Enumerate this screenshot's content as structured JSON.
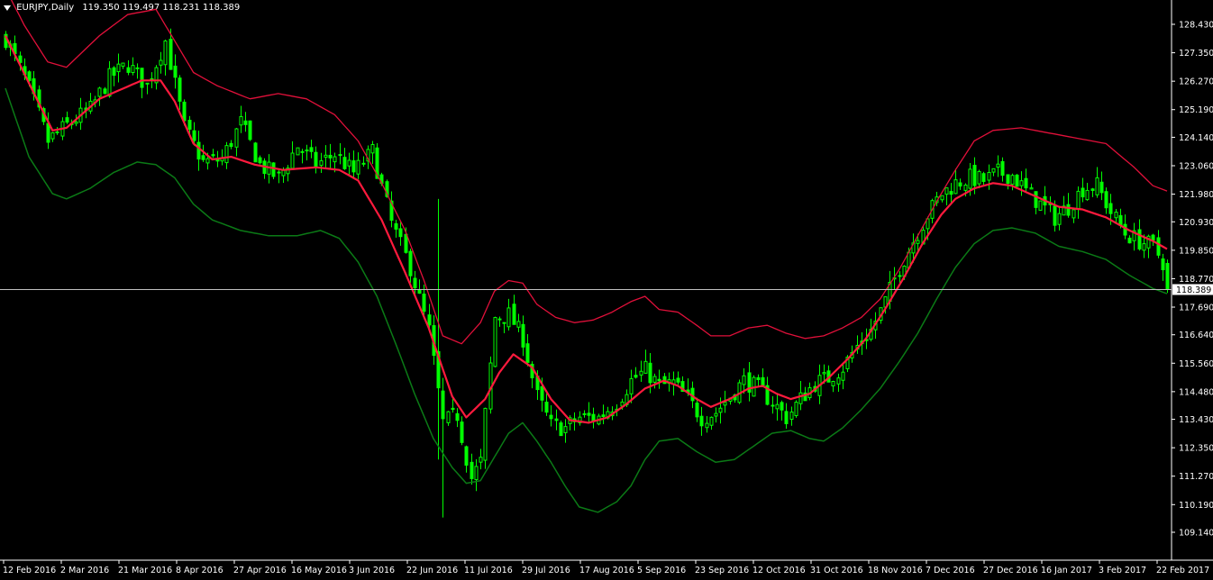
{
  "header": {
    "symbol": "EURJPY,Daily",
    "ohlc": "119.350 119.497 118.231 118.389"
  },
  "colors": {
    "background": "#000000",
    "axis": "#ffffff",
    "candles": "#00ff00",
    "middle_band": "#ff1a3d",
    "upper_band": "#e0103a",
    "lower_band": "#0b7a16",
    "price_line": "#c0c0c0"
  },
  "chart_data": {
    "type": "candlestick",
    "title": "EURJPY,Daily",
    "current_price": 118.389,
    "current_price_label": "118.389",
    "ylim": [
      109.14,
      128.43
    ],
    "y_ticks": [
      "128.430",
      "127.350",
      "126.270",
      "125.190",
      "124.140",
      "123.060",
      "121.980",
      "120.930",
      "119.850",
      "118.770",
      "117.690",
      "116.640",
      "115.560",
      "114.480",
      "113.430",
      "112.350",
      "111.270",
      "110.190",
      "109.140"
    ],
    "x_ticks": [
      "12 Feb 2016",
      "2 Mar 2016",
      "21 Mar 2016",
      "8 Apr 2016",
      "27 Apr 2016",
      "16 May 2016",
      "3 Jun 2016",
      "22 Jun 2016",
      "11 Jul 2016",
      "29 Jul 2016",
      "17 Aug 2016",
      "5 Sep 2016",
      "23 Sep 2016",
      "12 Oct 2016",
      "31 Oct 2016",
      "18 Nov 2016",
      "7 Dec 2016",
      "27 Dec 2016",
      "16 Jan 2017",
      "3 Feb 2017",
      "22 Feb 2017"
    ],
    "close_path": [
      [
        0,
        127.9
      ],
      [
        5,
        126.0
      ],
      [
        9,
        124.0
      ],
      [
        13,
        124.6
      ],
      [
        18,
        125.2
      ],
      [
        22,
        126.4
      ],
      [
        26,
        126.9
      ],
      [
        30,
        126.1
      ],
      [
        34,
        127.8
      ],
      [
        38,
        124.5
      ],
      [
        42,
        123.2
      ],
      [
        46,
        123.3
      ],
      [
        50,
        124.7
      ],
      [
        54,
        123.1
      ],
      [
        58,
        122.6
      ],
      [
        62,
        123.8
      ],
      [
        66,
        123.1
      ],
      [
        70,
        123.5
      ],
      [
        74,
        122.8
      ],
      [
        78,
        123.6
      ],
      [
        82,
        120.9
      ],
      [
        86,
        119.2
      ],
      [
        90,
        116.8
      ],
      [
        93,
        113.3
      ],
      [
        96,
        113.6
      ],
      [
        99,
        111.2
      ],
      [
        101,
        111.8
      ],
      [
        104,
        117.3
      ],
      [
        107,
        117.4
      ],
      [
        110,
        116.5
      ],
      [
        113,
        114.3
      ],
      [
        116,
        113.2
      ],
      [
        119,
        113.1
      ],
      [
        122,
        113.5
      ],
      [
        126,
        113.5
      ],
      [
        130,
        114.1
      ],
      [
        133,
        114.9
      ],
      [
        136,
        115.3
      ],
      [
        139,
        114.7
      ],
      [
        142,
        114.8
      ],
      [
        145,
        114.2
      ],
      [
        148,
        113.5
      ],
      [
        151,
        113.7
      ],
      [
        154,
        114.3
      ],
      [
        157,
        114.9
      ],
      [
        160,
        114.6
      ],
      [
        163,
        114.1
      ],
      [
        166,
        113.5
      ],
      [
        169,
        114.2
      ],
      [
        172,
        114.8
      ],
      [
        175,
        115.0
      ],
      [
        178,
        115.4
      ],
      [
        181,
        116.2
      ],
      [
        184,
        116.8
      ],
      [
        187,
        117.9
      ],
      [
        190,
        119.2
      ],
      [
        193,
        120.2
      ],
      [
        196,
        121.2
      ],
      [
        199,
        122.0
      ],
      [
        202,
        122.4
      ],
      [
        205,
        122.6
      ],
      [
        208,
        122.5
      ],
      [
        211,
        122.8
      ],
      [
        214,
        122.7
      ],
      [
        217,
        122.1
      ],
      [
        220,
        121.6
      ],
      [
        223,
        121.1
      ],
      [
        226,
        121.5
      ],
      [
        229,
        122.2
      ],
      [
        232,
        122.3
      ],
      [
        235,
        121.3
      ],
      [
        238,
        120.5
      ],
      [
        241,
        120.2
      ],
      [
        244,
        120.0
      ],
      [
        246,
        119.4
      ],
      [
        247,
        118.389
      ]
    ],
    "middle_band": [
      [
        0,
        128.0
      ],
      [
        10,
        124.4
      ],
      [
        13,
        124.5
      ],
      [
        20,
        125.6
      ],
      [
        29,
        126.3
      ],
      [
        33,
        126.3
      ],
      [
        36,
        125.5
      ],
      [
        40,
        123.9
      ],
      [
        44,
        123.3
      ],
      [
        48,
        123.4
      ],
      [
        53,
        123.1
      ],
      [
        59,
        122.9
      ],
      [
        66,
        123.0
      ],
      [
        71,
        122.9
      ],
      [
        75,
        122.5
      ],
      [
        80,
        121.0
      ],
      [
        85,
        119.0
      ],
      [
        90,
        116.9
      ],
      [
        95,
        114.3
      ],
      [
        98,
        113.5
      ],
      [
        102,
        114.2
      ],
      [
        105,
        115.2
      ],
      [
        108,
        115.9
      ],
      [
        112,
        115.4
      ],
      [
        116,
        114.2
      ],
      [
        120,
        113.4
      ],
      [
        124,
        113.3
      ],
      [
        128,
        113.5
      ],
      [
        132,
        114.0
      ],
      [
        136,
        114.6
      ],
      [
        140,
        114.9
      ],
      [
        143,
        114.7
      ],
      [
        147,
        114.2
      ],
      [
        150,
        113.9
      ],
      [
        154,
        114.2
      ],
      [
        158,
        114.6
      ],
      [
        161,
        114.7
      ],
      [
        164,
        114.4
      ],
      [
        167,
        114.2
      ],
      [
        171,
        114.4
      ],
      [
        175,
        115.0
      ],
      [
        179,
        115.7
      ],
      [
        183,
        116.5
      ],
      [
        187,
        117.6
      ],
      [
        191,
        118.8
      ],
      [
        195,
        120.1
      ],
      [
        199,
        121.2
      ],
      [
        202,
        121.8
      ],
      [
        206,
        122.2
      ],
      [
        210,
        122.4
      ],
      [
        214,
        122.3
      ],
      [
        219,
        121.9
      ],
      [
        224,
        121.5
      ],
      [
        229,
        121.4
      ],
      [
        234,
        121.1
      ],
      [
        239,
        120.6
      ],
      [
        244,
        120.2
      ],
      [
        247,
        119.9
      ]
    ],
    "upper_band": [
      [
        0,
        129.8
      ],
      [
        4,
        128.4
      ],
      [
        9,
        127.0
      ],
      [
        13,
        126.8
      ],
      [
        20,
        128.0
      ],
      [
        26,
        128.8
      ],
      [
        32,
        129.0
      ],
      [
        36,
        127.8
      ],
      [
        40,
        126.6
      ],
      [
        45,
        126.1
      ],
      [
        52,
        125.6
      ],
      [
        58,
        125.8
      ],
      [
        64,
        125.6
      ],
      [
        70,
        125.0
      ],
      [
        75,
        124.0
      ],
      [
        80,
        122.4
      ],
      [
        85,
        120.6
      ],
      [
        89,
        118.7
      ],
      [
        93,
        116.6
      ],
      [
        97,
        116.3
      ],
      [
        101,
        117.1
      ],
      [
        104,
        118.3
      ],
      [
        107,
        118.7
      ],
      [
        110,
        118.6
      ],
      [
        113,
        117.8
      ],
      [
        117,
        117.3
      ],
      [
        121,
        117.1
      ],
      [
        125,
        117.2
      ],
      [
        129,
        117.5
      ],
      [
        133,
        117.9
      ],
      [
        136,
        118.1
      ],
      [
        139,
        117.6
      ],
      [
        143,
        117.5
      ],
      [
        147,
        117.0
      ],
      [
        150,
        116.6
      ],
      [
        154,
        116.6
      ],
      [
        158,
        116.9
      ],
      [
        162,
        117.0
      ],
      [
        166,
        116.7
      ],
      [
        170,
        116.5
      ],
      [
        174,
        116.6
      ],
      [
        178,
        116.9
      ],
      [
        182,
        117.3
      ],
      [
        186,
        118.0
      ],
      [
        190,
        119.1
      ],
      [
        194,
        120.4
      ],
      [
        198,
        121.7
      ],
      [
        202,
        122.9
      ],
      [
        206,
        124.0
      ],
      [
        210,
        124.4
      ],
      [
        216,
        124.5
      ],
      [
        222,
        124.3
      ],
      [
        228,
        124.1
      ],
      [
        234,
        123.9
      ],
      [
        240,
        123.0
      ],
      [
        244,
        122.3
      ],
      [
        247,
        122.1
      ]
    ],
    "lower_band": [
      [
        0,
        126.0
      ],
      [
        5,
        123.4
      ],
      [
        10,
        122.0
      ],
      [
        13,
        121.8
      ],
      [
        18,
        122.2
      ],
      [
        23,
        122.8
      ],
      [
        28,
        123.2
      ],
      [
        32,
        123.1
      ],
      [
        36,
        122.6
      ],
      [
        40,
        121.6
      ],
      [
        44,
        121.0
      ],
      [
        50,
        120.6
      ],
      [
        56,
        120.4
      ],
      [
        62,
        120.4
      ],
      [
        67,
        120.6
      ],
      [
        71,
        120.3
      ],
      [
        75,
        119.4
      ],
      [
        79,
        118.1
      ],
      [
        83,
        116.3
      ],
      [
        87,
        114.4
      ],
      [
        91,
        112.7
      ],
      [
        95,
        111.6
      ],
      [
        98,
        111.0
      ],
      [
        101,
        111.1
      ],
      [
        104,
        112.0
      ],
      [
        107,
        112.9
      ],
      [
        110,
        113.3
      ],
      [
        113,
        112.6
      ],
      [
        116,
        111.8
      ],
      [
        119,
        110.9
      ],
      [
        122,
        110.1
      ],
      [
        126,
        109.9
      ],
      [
        130,
        110.3
      ],
      [
        133,
        110.9
      ],
      [
        136,
        111.9
      ],
      [
        139,
        112.6
      ],
      [
        143,
        112.7
      ],
      [
        147,
        112.2
      ],
      [
        151,
        111.8
      ],
      [
        155,
        111.9
      ],
      [
        159,
        112.4
      ],
      [
        163,
        112.9
      ],
      [
        167,
        113.0
      ],
      [
        171,
        112.7
      ],
      [
        174,
        112.6
      ],
      [
        178,
        113.1
      ],
      [
        182,
        113.8
      ],
      [
        186,
        114.6
      ],
      [
        190,
        115.6
      ],
      [
        194,
        116.7
      ],
      [
        198,
        118.0
      ],
      [
        202,
        119.2
      ],
      [
        206,
        120.1
      ],
      [
        210,
        120.6
      ],
      [
        214,
        120.7
      ],
      [
        219,
        120.5
      ],
      [
        224,
        120.0
      ],
      [
        229,
        119.8
      ],
      [
        234,
        119.5
      ],
      [
        239,
        118.9
      ],
      [
        244,
        118.4
      ],
      [
        247,
        118.2
      ]
    ]
  }
}
